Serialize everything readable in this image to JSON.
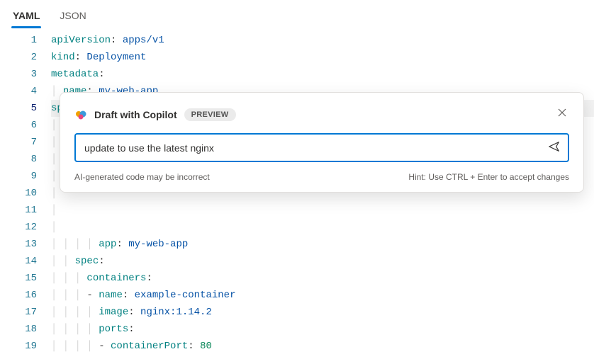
{
  "tabs": {
    "yaml": "YAML",
    "json": "JSON"
  },
  "gutter": {
    "lines": [
      "1",
      "2",
      "3",
      "4",
      "5",
      "6",
      "7",
      "8",
      "9",
      "10",
      "11",
      "12",
      "13",
      "14",
      "15",
      "16",
      "17",
      "18",
      "19"
    ],
    "current": 5
  },
  "code": {
    "l1_key": "apiVersion",
    "l1_val": "apps/v1",
    "l2_key": "kind",
    "l2_val": "Deployment",
    "l3_key": "metadata",
    "l4_key": "name",
    "l4_val": "my-web-app",
    "l5_key": "spec",
    "l13_key": "app",
    "l13_val": "my-web-app",
    "l14_key": "spec",
    "l15_key": "containers",
    "l16_key": "name",
    "l16_val": "example-container",
    "l17_key": "image",
    "l17_val": "nginx:1.14.2",
    "l18_key": "ports",
    "l19_key": "containerPort",
    "l19_val": "80"
  },
  "popup": {
    "title": "Draft with Copilot",
    "badge": "PREVIEW",
    "prompt": "update to use the latest nginx",
    "disclaimer": "AI-generated code may be incorrect",
    "hint": "Hint: Use CTRL + Enter to accept changes"
  }
}
